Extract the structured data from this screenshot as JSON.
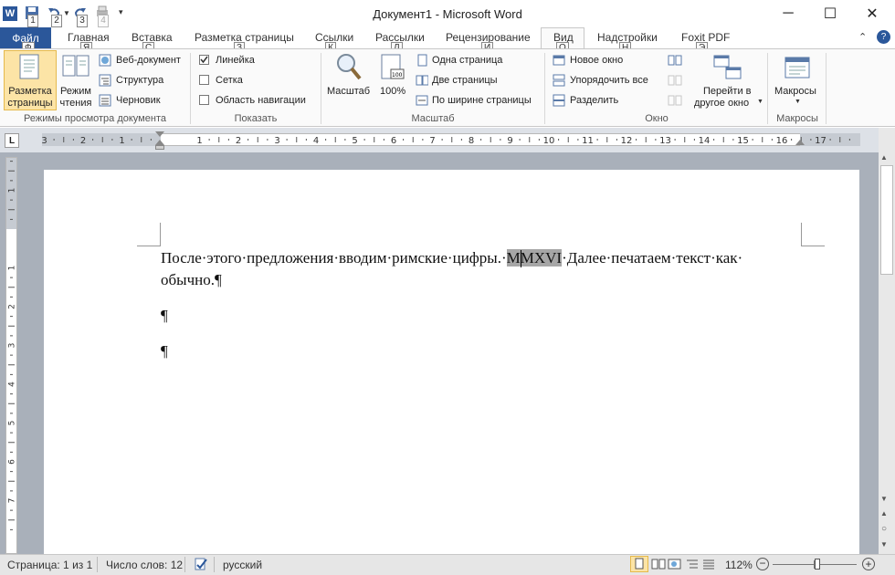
{
  "window": {
    "title": "Документ1 - Microsoft Word"
  },
  "qat": {
    "keytips": [
      "1",
      "2",
      "3",
      "4"
    ]
  },
  "tabs": [
    {
      "label": "Файл",
      "keytip": "Ф"
    },
    {
      "label": "Главная",
      "keytip": "Я"
    },
    {
      "label": "Вставка",
      "keytip": "С"
    },
    {
      "label": "Разметка страницы",
      "keytip": "З"
    },
    {
      "label": "Ссылки",
      "keytip": "К"
    },
    {
      "label": "Рассылки",
      "keytip": "Л"
    },
    {
      "label": "Рецензирование",
      "keytip": "И"
    },
    {
      "label": "Вид",
      "keytip": "О"
    },
    {
      "label": "Надстройки",
      "keytip": "Н"
    },
    {
      "label": "Foxit PDF",
      "keytip": "Э"
    }
  ],
  "ribbon": {
    "views": {
      "label": "Режимы просмотра документа",
      "print_layout": "Разметка страницы",
      "reading": "Режим чтения",
      "web": "Веб-документ",
      "outline": "Структура",
      "draft": "Черновик"
    },
    "show": {
      "label": "Показать",
      "ruler": "Линейка",
      "grid": "Сетка",
      "nav": "Область навигации"
    },
    "zoom": {
      "label": "Масштаб",
      "zoom_btn": "Масштаб",
      "hundred": "100%",
      "one_page": "Одна страница",
      "two_pages": "Две страницы",
      "page_width": "По ширине страницы"
    },
    "window": {
      "label": "Окно",
      "new_window": "Новое окно",
      "arrange_all": "Упорядочить все",
      "split": "Разделить",
      "switch_line1": "Перейти в",
      "switch_line2": "другое окно"
    },
    "macros": {
      "label": "Макросы",
      "btn": "Макросы"
    }
  },
  "ruler": {
    "h_numbers": [
      "3",
      "2",
      "1",
      "1",
      "2",
      "3",
      "4",
      "5",
      "6",
      "7",
      "8",
      "9",
      "10",
      "11",
      "12",
      "13",
      "14",
      "15",
      "16",
      "17"
    ],
    "v_numbers": [
      "2",
      "1",
      "1",
      "2",
      "3",
      "4",
      "5",
      "6",
      "7"
    ]
  },
  "document": {
    "line1_before": "После·этого·предложения·вводим·римские·цифры.·",
    "selection": "MMXVI",
    "line1_after": "·Далее·печатаем·текст·как·",
    "line2": "обычно.¶",
    "para_mark": "¶"
  },
  "status": {
    "page": "Страница: 1 из 1",
    "words": "Число слов: 12",
    "lang": "русский",
    "zoom": "112%"
  },
  "colors": {
    "file_tab": "#2b579a",
    "doc_bg": "#a9b0ba",
    "selection": "#a6a6a6"
  }
}
